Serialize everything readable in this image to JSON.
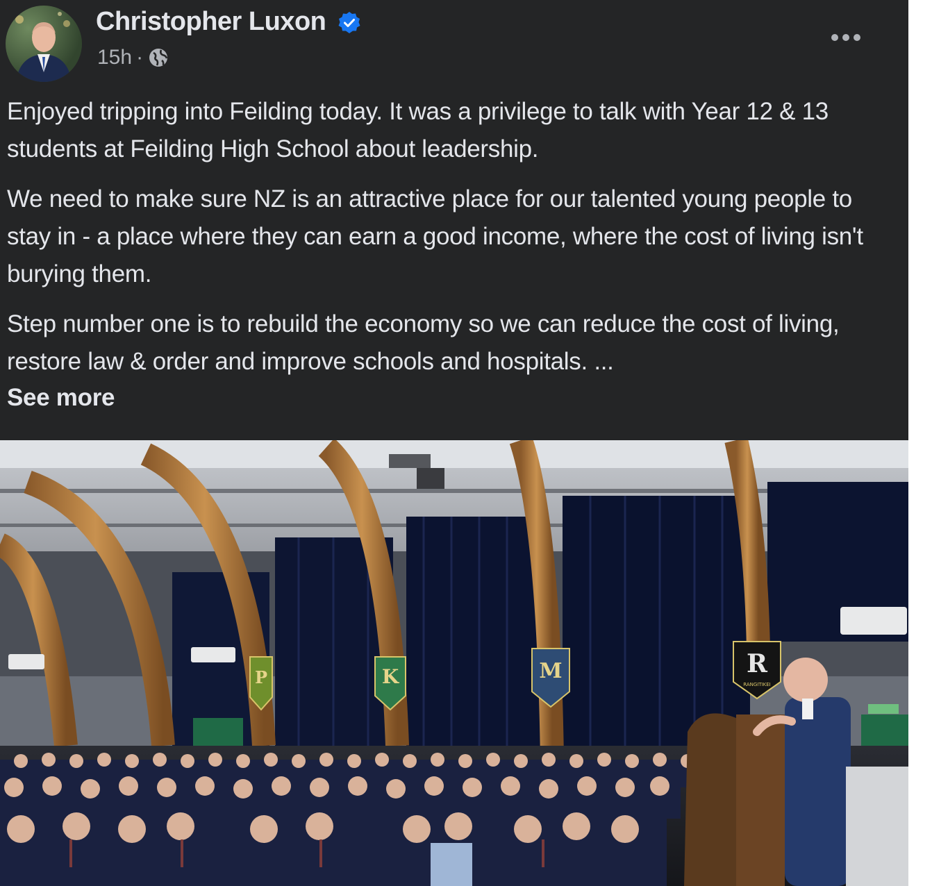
{
  "post": {
    "author": {
      "name": "Christopher Luxon",
      "verified": true,
      "verified_icon": "verified-badge-icon",
      "avatar_icon": "profile-avatar"
    },
    "meta": {
      "time": "15h",
      "separator": "·",
      "audience_icon": "globe-public-icon"
    },
    "more_icon": "more-options-icon",
    "body": {
      "paragraph_1": "Enjoyed tripping into Feilding today. It was a privilege to talk with Year 12 & 13 students at Feilding High School about leadership.",
      "paragraph_2": "We need to make sure NZ is an attractive place for our talented young people to stay in - a place where they can earn a good income, where the cost of living isn't burying them.",
      "paragraph_3": "Step number one is to rebuild the economy so we can reduce the cost of living, restore law & order and improve schools and hospitals. ...",
      "see_more": "See more"
    },
    "photo": {
      "banners": [
        "P",
        "K",
        "M",
        "R"
      ],
      "banner_caption": "RANGITIKEI"
    }
  },
  "colors": {
    "card_background": "#242526",
    "primary_text": "#e4e6eb",
    "secondary_text": "#b0b3b8",
    "verified_blue": "#1877f2"
  }
}
